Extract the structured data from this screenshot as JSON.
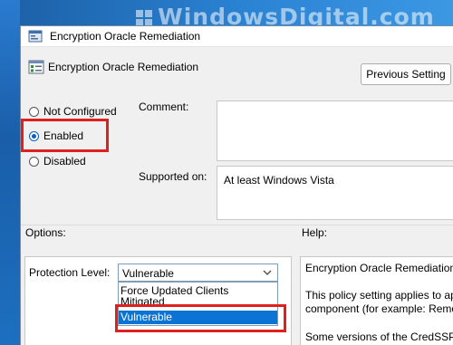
{
  "watermark": "WindowsDigital.com",
  "window": {
    "title": "Encryption Oracle Remediation",
    "title_icon": "policy-icon"
  },
  "header": {
    "setting_name": "Encryption Oracle Remediation",
    "setting_icon": "policy-setting-icon",
    "previous_button": "Previous Setting"
  },
  "state": {
    "options": [
      {
        "label": "Not Configured",
        "checked": false
      },
      {
        "label": "Enabled",
        "checked": true
      },
      {
        "label": "Disabled",
        "checked": false
      }
    ]
  },
  "comment": {
    "label": "Comment:",
    "value": ""
  },
  "supported": {
    "label": "Supported on:",
    "value": "At least Windows Vista"
  },
  "options_pane": {
    "label": "Options:",
    "protection_label": "Protection Level:",
    "selected_value": "Vulnerable",
    "dropdown_items": [
      "Force Updated Clients",
      "Mitigated",
      "Vulnerable"
    ],
    "highlighted_item": "Vulnerable"
  },
  "help_pane": {
    "label": "Help:",
    "lines": [
      "Encryption Oracle Remediation",
      "This policy setting applies to ap",
      "component (for example: Remo",
      "Some versions of the CredSSP p"
    ]
  },
  "colors": {
    "highlight_box": "#e0201e",
    "selection": "#0b73d4",
    "radio_checked": "#0a5ec0"
  }
}
